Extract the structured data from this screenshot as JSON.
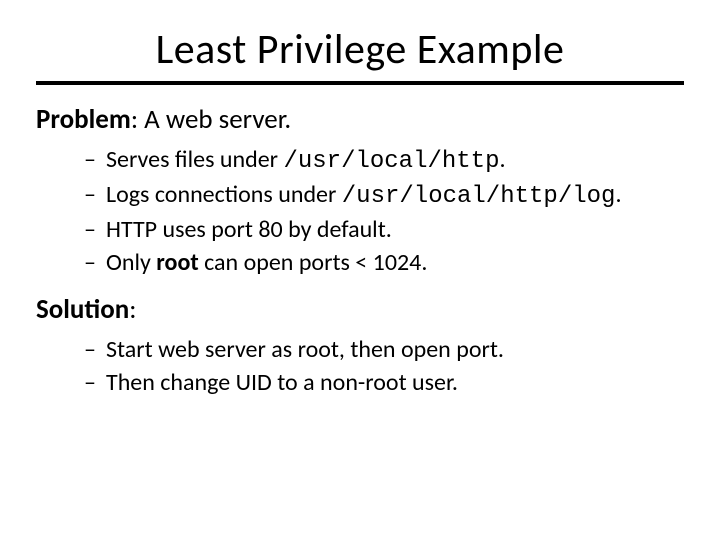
{
  "title": "Least Privilege Example",
  "problem": {
    "label": "Problem",
    "text": ": A web server.",
    "items": [
      {
        "pre": "Serves files under ",
        "code": "/usr/local/http",
        "post": "."
      },
      {
        "pre": "Logs connections under ",
        "code": "/usr/local/http/log",
        "post": "."
      },
      {
        "plain": "HTTP uses port 80 by default."
      },
      {
        "pre": "Only ",
        "bold": "root",
        "post": " can open ports < 1024."
      }
    ]
  },
  "solution": {
    "label": "Solution",
    "text": ":",
    "items": [
      {
        "plain": "Start web server as root, then open port."
      },
      {
        "plain": "Then change UID to a non-root user."
      }
    ]
  }
}
